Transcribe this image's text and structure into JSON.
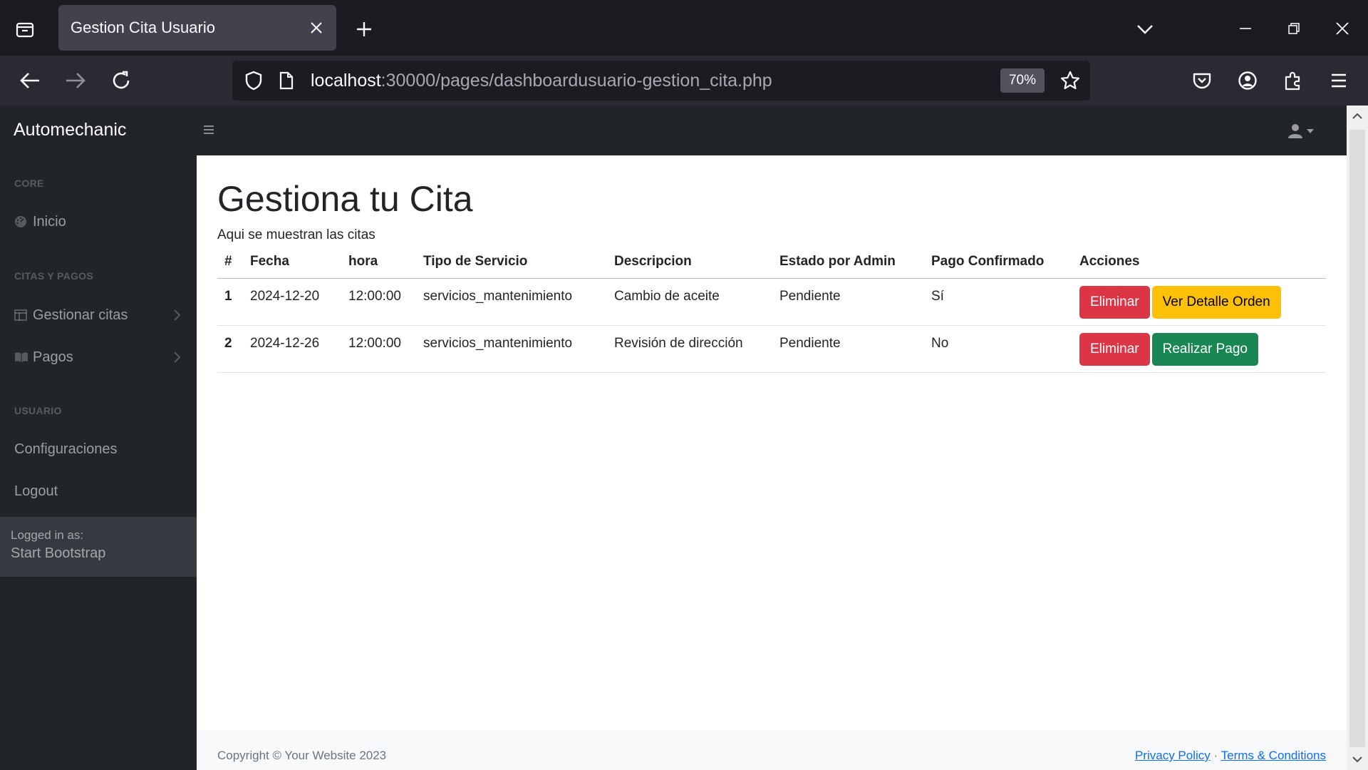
{
  "browser": {
    "tab_title": "Gestion Cita Usuario",
    "url_host": "localhost",
    "url_path": ":30000/pages/dashboardusuario-gestion_cita.php",
    "zoom": "70%"
  },
  "topnav": {
    "brand": "Automechanic"
  },
  "sidebar": {
    "heading_core": "Core",
    "link_inicio": "Inicio",
    "heading_citas": "Citas y Pagos",
    "link_gestionar": "Gestionar citas",
    "link_pagos": "Pagos",
    "heading_usuario": "Usuario",
    "link_config": "Configuraciones",
    "link_logout": "Logout",
    "footer_label": "Logged in as:",
    "footer_name": "Start Bootstrap"
  },
  "main": {
    "title": "Gestiona tu Cita",
    "subtitle": "Aqui se muestran las citas",
    "columns": [
      "#",
      "Fecha",
      "hora",
      "Tipo de Servicio",
      "Descripcion",
      "Estado por Admin",
      "Pago Confirmado",
      "Acciones"
    ],
    "rows": [
      {
        "num": "1",
        "fecha": "2024-12-20",
        "hora": "12:00:00",
        "tipo": "servicios_mantenimiento",
        "descripcion": "Cambio de aceite",
        "estado": "Pendiente",
        "pago": "Sí",
        "btn1": "Eliminar",
        "btn2": "Ver Detalle Orden"
      },
      {
        "num": "2",
        "fecha": "2024-12-26",
        "hora": "12:00:00",
        "tipo": "servicios_mantenimiento",
        "descripcion": "Revisión de dirección",
        "estado": "Pendiente",
        "pago": "No",
        "btn1": "Eliminar",
        "btn2": "Realizar Pago"
      }
    ]
  },
  "footer": {
    "copyright": "Copyright © Your Website 2023",
    "privacy": "Privacy Policy",
    "separator": "·",
    "terms": "Terms & Conditions"
  },
  "colors": {
    "danger": "#dc3545",
    "warning": "#ffc107",
    "success": "#198754",
    "dark": "#212529"
  }
}
